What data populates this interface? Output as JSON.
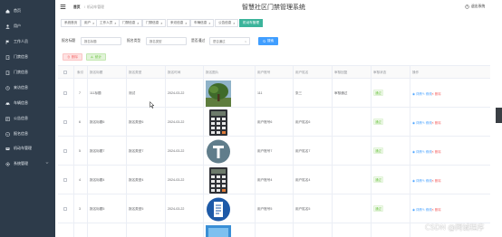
{
  "app": {
    "title": "智慧社区门禁管理系统",
    "logout_label": "退出系统"
  },
  "breadcrumb": {
    "home": "首页",
    "separator": "/",
    "current": "机动车管理"
  },
  "sidebar": {
    "items": [
      {
        "label": "首页",
        "icon": "home-icon"
      },
      {
        "label": "用户",
        "icon": "user-icon"
      },
      {
        "label": "工作人员",
        "icon": "flag-icon"
      },
      {
        "label": "门禁信息",
        "icon": "door-icon"
      },
      {
        "label": "门禁信息",
        "icon": "door-icon"
      },
      {
        "label": "来访信息",
        "icon": "visitor-icon"
      },
      {
        "label": "车辆信息",
        "icon": "car-icon"
      },
      {
        "label": "公告信息",
        "icon": "notice-icon"
      },
      {
        "label": "报名信息",
        "icon": "form-icon"
      },
      {
        "label": "机动车管理",
        "icon": "vehicle-icon"
      },
      {
        "label": "系统管理",
        "icon": "gear-icon"
      }
    ]
  },
  "tabs": [
    {
      "label": "系统首页",
      "closable": false
    },
    {
      "label": "用户",
      "closable": true
    },
    {
      "label": "工作人员",
      "closable": true
    },
    {
      "label": "门禁信息",
      "closable": true
    },
    {
      "label": "门禁信息",
      "closable": true
    },
    {
      "label": "来访信息",
      "closable": true
    },
    {
      "label": "车辆信息",
      "closable": true
    },
    {
      "label": "公告信息",
      "closable": true
    },
    {
      "label": "机动车管理",
      "closable": true,
      "active": true
    }
  ],
  "search": {
    "field1_label": "报名标题",
    "field1_placeholder": "报名标题",
    "field2_label": "报名类型",
    "field2_placeholder": "报名类型",
    "field3_label": "是否通过",
    "field3_placeholder": "是否通过",
    "button_label": "搜索"
  },
  "actions": {
    "delete_label": "删除",
    "stats_label": "统计"
  },
  "table": {
    "headers": [
      "索引",
      "报名标题",
      "报名类型",
      "报名时间",
      "报名图片",
      "用户账号",
      "用户姓名",
      "审核回复",
      "审核状态",
      "操作"
    ],
    "rows": [
      {
        "index": "7",
        "title": "111标题",
        "type": "测试",
        "time": "2024-03-22",
        "image": "tree-photo",
        "account": "111",
        "name": "张三",
        "reply": "审核通过",
        "status": "通过"
      },
      {
        "index": "6",
        "title": "报名标题6",
        "type": "报名类型6",
        "time": "2024-03-22",
        "image": "calculator-icon",
        "account": "用户账号6",
        "name": "用户姓名6",
        "reply": "",
        "status": "通过"
      },
      {
        "index": "5",
        "title": "报名标题7",
        "type": "报名类型7",
        "time": "2024-03-22",
        "image": "letter-t-icon",
        "account": "用户账号7",
        "name": "用户姓名7",
        "reply": "",
        "status": "通过"
      },
      {
        "index": "4",
        "title": "报名标题4",
        "type": "报名类型4",
        "time": "2024-03-22",
        "image": "calculator-icon",
        "account": "用户账号4",
        "name": "用户姓名4",
        "reply": "",
        "status": "通过"
      },
      {
        "index": "3",
        "title": "报名标题5",
        "type": "报名类型5",
        "time": "2024-03-22",
        "image": "document-icon",
        "account": "用户账号5",
        "name": "用户姓名5",
        "reply": "",
        "status": "通过"
      }
    ],
    "op_view": "详情",
    "op_edit": "修改",
    "op_delete": "删除"
  },
  "watermark": "CSDN @网诚程序",
  "colors": {
    "sidebar_bg": "#2d3b4a",
    "accent": "#3cb49b",
    "primary": "#409eff",
    "danger": "#f56c6c",
    "success": "#67c23a"
  }
}
